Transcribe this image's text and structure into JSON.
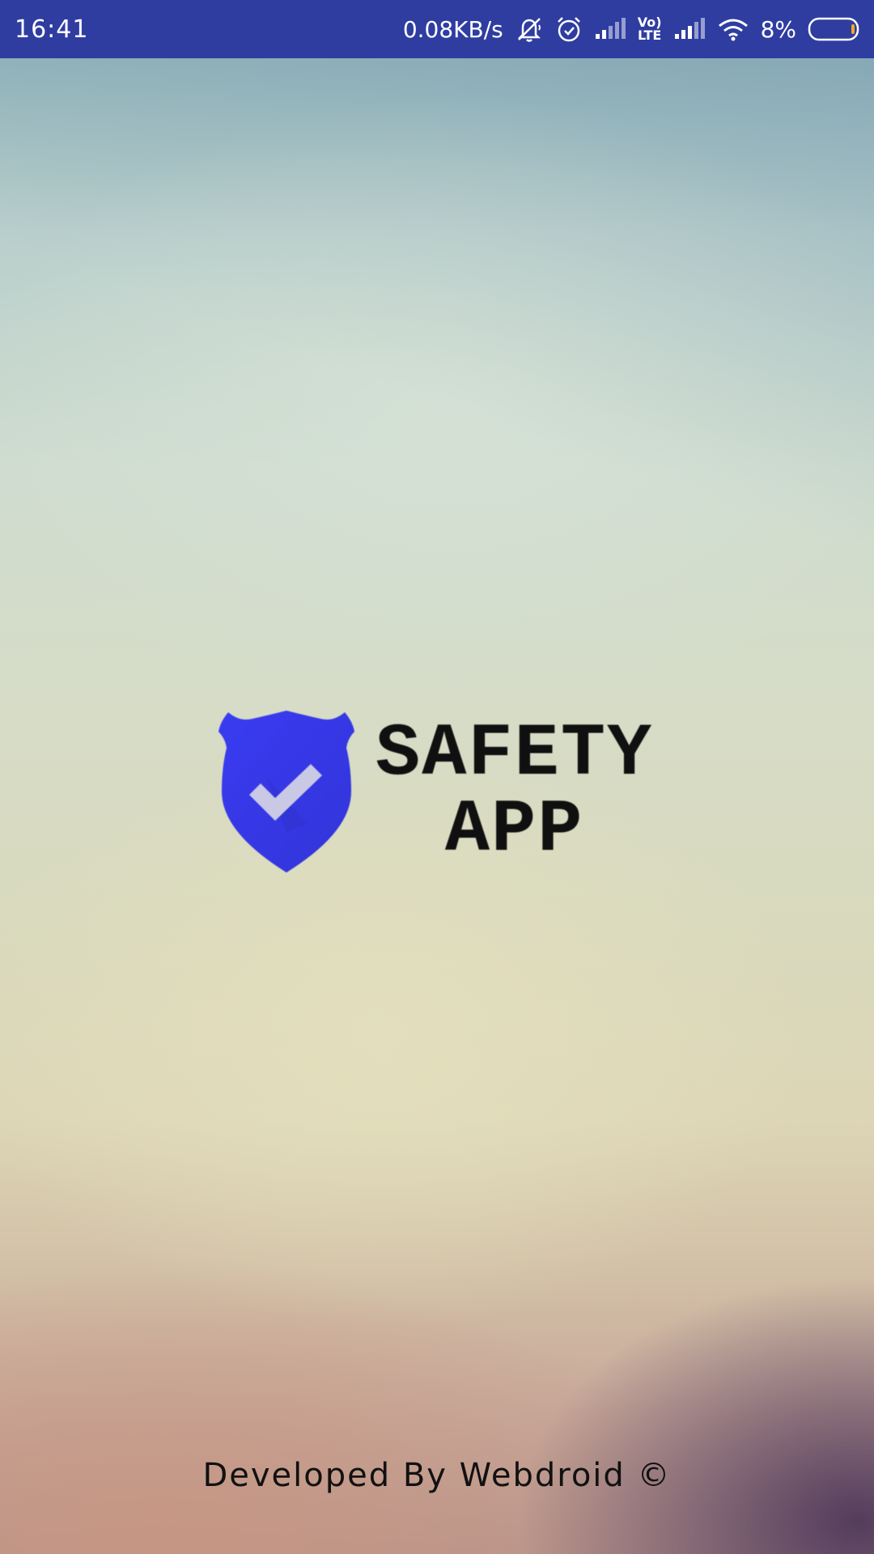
{
  "status_bar": {
    "time": "16:41",
    "net_speed": "0.08KB/s",
    "volte_label_top": "Vo)",
    "volte_label_bottom": "LTE",
    "battery": "8%",
    "background_color": "#2f3da1"
  },
  "logo": {
    "line1": "SAFETY",
    "line2": "APP",
    "shield_color": "#3d3df0",
    "icons": [
      "shield-icon",
      "checkmark-icon"
    ]
  },
  "footer": {
    "credit": "Developed By Webdroid ©"
  }
}
